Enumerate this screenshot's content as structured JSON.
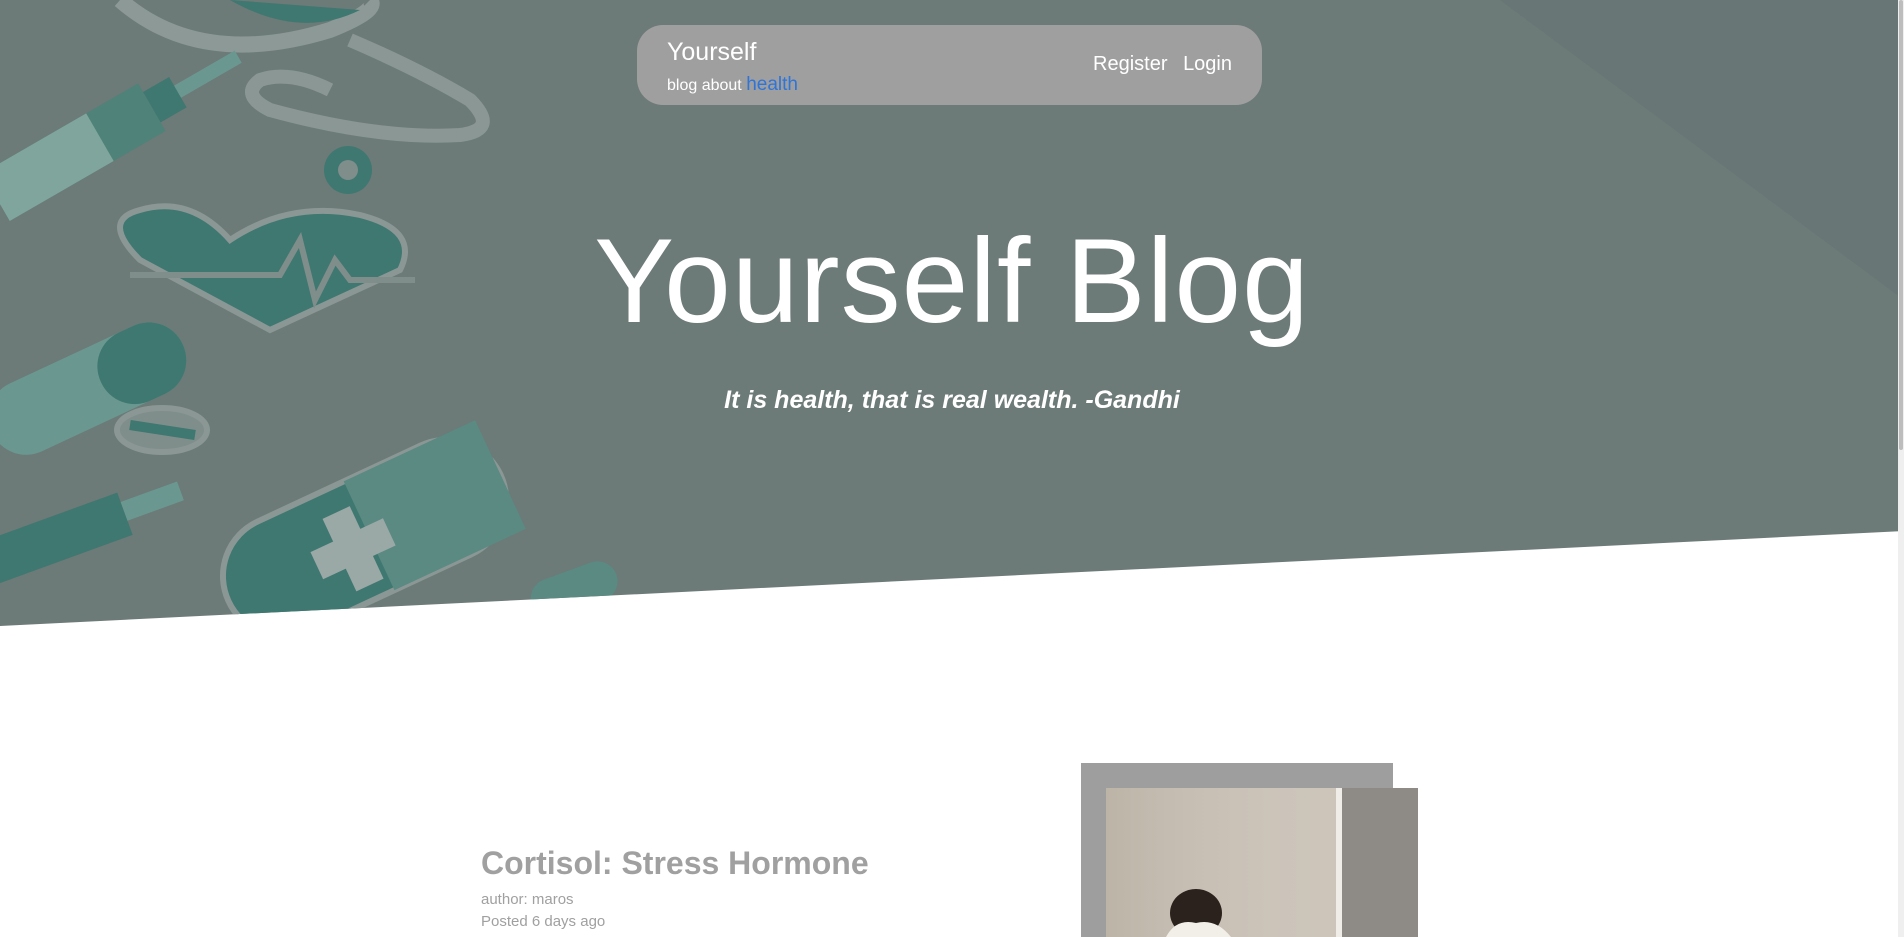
{
  "navbar": {
    "brand_title": "Yourself",
    "brand_sub_prefix": "blog about",
    "brand_sub_accent": "health",
    "register_label": "Register",
    "login_label": "Login"
  },
  "hero": {
    "title": "Yourself Blog",
    "quote": "It is health, that is real wealth. -Gandhi"
  },
  "post": {
    "title": "Cortisol: Stress Hormone",
    "author": "author: maros",
    "posted": "Posted 6 days ago"
  },
  "colors": {
    "hero_overlay": "#6c7a78",
    "navbar_bg": "#a09f9f",
    "accent": "#2f74d8",
    "teal": "#3d7a70"
  }
}
